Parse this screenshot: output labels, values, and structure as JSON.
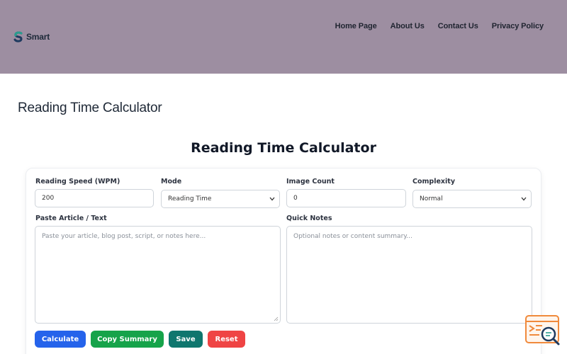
{
  "header": {
    "logo_text": "Smart",
    "nav": [
      "Home Page",
      "About Us",
      "Contact Us",
      "Privacy Policy"
    ]
  },
  "page_title": "Reading Time Calculator",
  "tool": {
    "title": "Reading Time Calculator",
    "fields": {
      "speed": {
        "label": "Reading Speed (WPM)",
        "value": "200"
      },
      "mode": {
        "label": "Mode",
        "value": "Reading Time"
      },
      "image_count": {
        "label": "Image Count",
        "value": "0"
      },
      "complexity": {
        "label": "Complexity",
        "value": "Normal"
      },
      "article": {
        "label": "Paste Article / Text",
        "placeholder": "Paste your article, blog post, script, or notes here..."
      },
      "notes": {
        "label": "Quick Notes",
        "placeholder": "Optional notes or content summary..."
      }
    },
    "buttons": {
      "calculate": "Calculate",
      "copy_summary": "Copy Summary",
      "save": "Save",
      "reset": "Reset"
    }
  },
  "colors": {
    "header_bg": "#9d8ea1",
    "calculate": "#2563eb",
    "copy_summary": "#16a34a",
    "save": "#0f766e",
    "reset": "#ef4444",
    "widget_accent": "#f08a3c"
  },
  "icons": {
    "logo": "smart-logo-icon",
    "select_arrow": "chevron-down-icon",
    "widget": "search-chat-icon"
  }
}
